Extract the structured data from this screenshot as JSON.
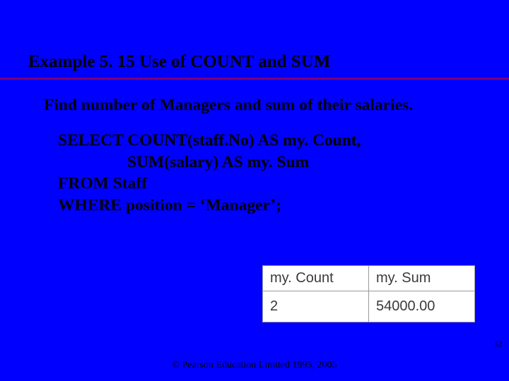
{
  "title": "Example 5. 15  Use of COUNT and SUM",
  "problem_html": "Find number of Managers and sum of their salaries.",
  "sql": {
    "l1": "SELECT COUNT(staff.No) AS my. Count,",
    "l2": "SUM(salary) AS my. Sum",
    "l3": "FROM Staff",
    "l4": "WHERE position = ‘Manager’;"
  },
  "chart_data": {
    "type": "table",
    "columns": [
      "my. Count",
      "my. Sum"
    ],
    "rows": [
      [
        "2",
        "54000.00"
      ]
    ]
  },
  "slide_number": "52",
  "copyright": "© Pearson Education Limited 1995, 2005"
}
